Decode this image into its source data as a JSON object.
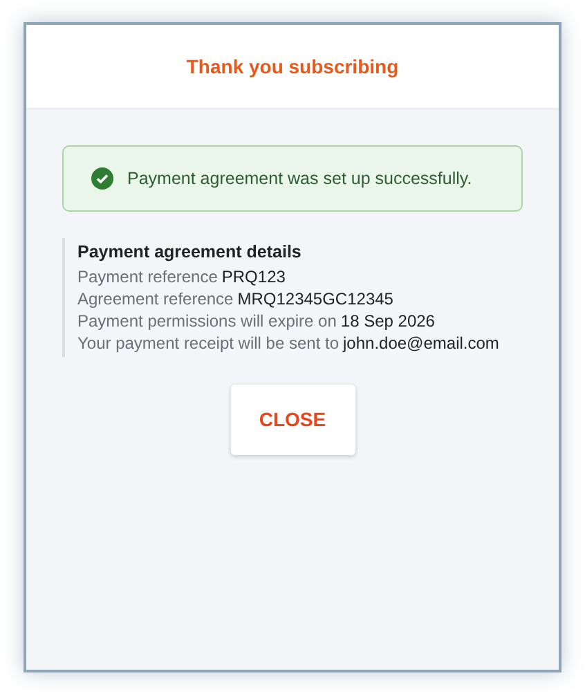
{
  "dialog": {
    "title": "Thank you subscribing"
  },
  "alert": {
    "kind": "success",
    "message": "Payment agreement was set up successfully."
  },
  "details": {
    "heading": "Payment agreement details",
    "rows": [
      {
        "label": "Payment reference",
        "value": "PRQ123"
      },
      {
        "label": "Agreement reference",
        "value": "MRQ12345GC12345"
      },
      {
        "label": "Payment permissions will expire on",
        "value": "18 Sep 2026"
      },
      {
        "label": "Your payment receipt will be sent to",
        "value": "john.doe@email.com"
      }
    ]
  },
  "buttons": [
    {
      "label": "CLOSE"
    }
  ]
}
